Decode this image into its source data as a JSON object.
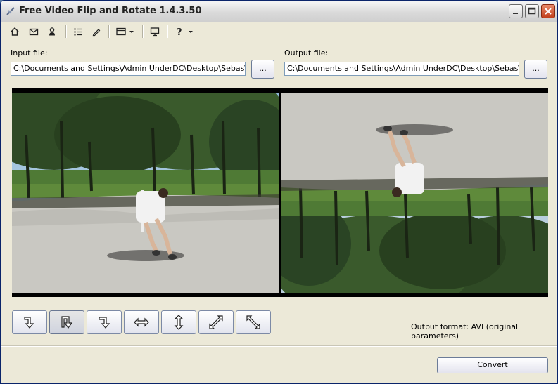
{
  "window": {
    "title": "Free Video Flip and Rotate 1.4.3.50"
  },
  "toolbar": {
    "icons": [
      "home-icon",
      "mail-icon",
      "user-icon",
      "list-icon",
      "pencil-icon",
      "menu-icon",
      "monitor-icon",
      "help-icon"
    ]
  },
  "input": {
    "label": "Input file:",
    "value": "C:\\Documents and Settings\\Admin UnderDC\\Desktop\\Sebas\\YouTube",
    "browse_label": "..."
  },
  "output": {
    "label": "Output file:",
    "value": "C:\\Documents and Settings\\Admin UnderDC\\Desktop\\Sebas\\YouTube",
    "browse_label": "..."
  },
  "rotation_buttons": [
    {
      "icon": "rotate-left-icon",
      "active": false
    },
    {
      "icon": "rotate-180-icon",
      "active": true
    },
    {
      "icon": "rotate-right-icon",
      "active": false
    },
    {
      "icon": "flip-horizontal-icon",
      "active": false
    },
    {
      "icon": "flip-vertical-icon",
      "active": false
    },
    {
      "icon": "transpose-icon",
      "active": false
    },
    {
      "icon": "transverse-icon",
      "active": false
    }
  ],
  "output_format": "Output format: AVI (original parameters)",
  "convert_label": "Convert",
  "colors": {
    "title_bar": "#dadada",
    "close_button": "#c2401c",
    "window_bg": "#ece9d8",
    "field_border": "#7f9db9"
  }
}
